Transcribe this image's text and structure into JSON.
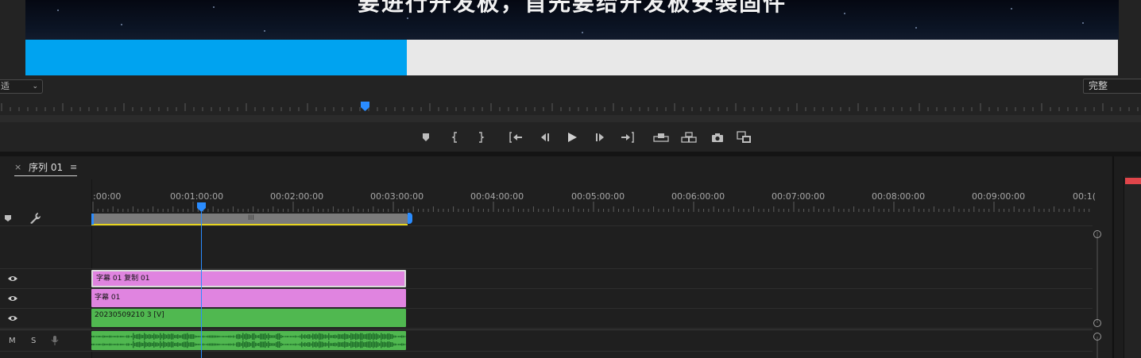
{
  "program_monitor": {
    "video_caption": "要进行开发板，首先要给开发板安装固件",
    "progress_fraction": 0.349,
    "zoom_label": "适",
    "resolution_label": "完整"
  },
  "transport_controls": [
    {
      "name": "add-marker-button",
      "icon": "marker-icon"
    },
    {
      "name": "mark-in-button",
      "icon": "mark-in-icon"
    },
    {
      "name": "mark-out-button",
      "icon": "mark-out-icon"
    },
    {
      "name": "go-to-in-button",
      "icon": "go-to-in-icon"
    },
    {
      "name": "step-back-button",
      "icon": "step-back-icon"
    },
    {
      "name": "play-button",
      "icon": "play-icon"
    },
    {
      "name": "step-forward-button",
      "icon": "step-forward-icon"
    },
    {
      "name": "go-to-out-button",
      "icon": "go-to-out-icon"
    },
    {
      "name": "lift-button",
      "icon": "lift-icon"
    },
    {
      "name": "extract-button",
      "icon": "extract-icon"
    },
    {
      "name": "export-frame-button",
      "icon": "camera-icon"
    },
    {
      "name": "button-editor-button",
      "icon": "button-editor-icon"
    }
  ],
  "timeline": {
    "tab": {
      "close": "×",
      "title": "序列 01",
      "menu": "≡"
    },
    "timecodes": [
      ":00:00",
      "00:01:00:00",
      "00:02:00:00",
      "00:03:00:00",
      "00:04:00:00",
      "00:05:00:00",
      "00:06:00:00",
      "00:07:00:00",
      "00:08:00:00",
      "00:09:00:00",
      "00:1("
    ],
    "work_area_grip": "III",
    "clips": {
      "v3": "字幕 01 复制 01",
      "v2": "字幕 01",
      "v1": "20230509210 3 [V]"
    },
    "audio_buttons": {
      "mute": "M",
      "solo": "S"
    }
  },
  "colors": {
    "accent_blue": "#00a3f0",
    "playhead_blue": "#2a8cff",
    "caption_clip": "#e084e0",
    "video_clip": "#50b850",
    "work_area_yellow": "#e8d520"
  }
}
